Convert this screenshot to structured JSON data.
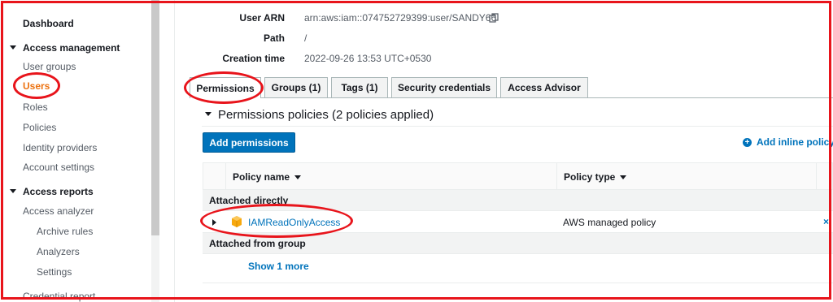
{
  "sidebar": {
    "dashboard": "Dashboard",
    "access_management": {
      "label": "Access management",
      "items": [
        "User groups",
        "Users",
        "Roles",
        "Policies",
        "Identity providers",
        "Account settings"
      ]
    },
    "access_reports": {
      "label": "Access reports",
      "items": [
        "Access analyzer"
      ],
      "sub_items": [
        "Archive rules",
        "Analyzers",
        "Settings"
      ],
      "more": "Credential report"
    }
  },
  "summary": {
    "arn_label": "User ARN",
    "arn_value": "arn:aws:iam::074752729399:user/SANDY66",
    "path_label": "Path",
    "path_value": "/",
    "created_label": "Creation time",
    "created_value": "2022-09-26 13:53 UTC+0530"
  },
  "tabs": [
    {
      "label": "Permissions",
      "active": true
    },
    {
      "label": "Groups (1)",
      "active": false
    },
    {
      "label": "Tags (1)",
      "active": false
    },
    {
      "label": "Security credentials",
      "active": false
    },
    {
      "label": "Access Advisor",
      "active": false
    }
  ],
  "permissions": {
    "title": "Permissions policies (2 policies applied)",
    "add_button": "Add permissions",
    "add_inline": "Add inline policy",
    "columns": {
      "name": "Policy name",
      "type": "Policy type"
    },
    "group_attached": "Attached directly",
    "policy": {
      "name": "IAMReadOnlyAccess",
      "type": "AWS managed policy",
      "remove": "×"
    },
    "group_from_group": "Attached from group",
    "show_more": "Show 1 more"
  },
  "colors": {
    "accent": "#0073bb",
    "active_nav": "#ec7211",
    "annotation": "#e8141b"
  }
}
